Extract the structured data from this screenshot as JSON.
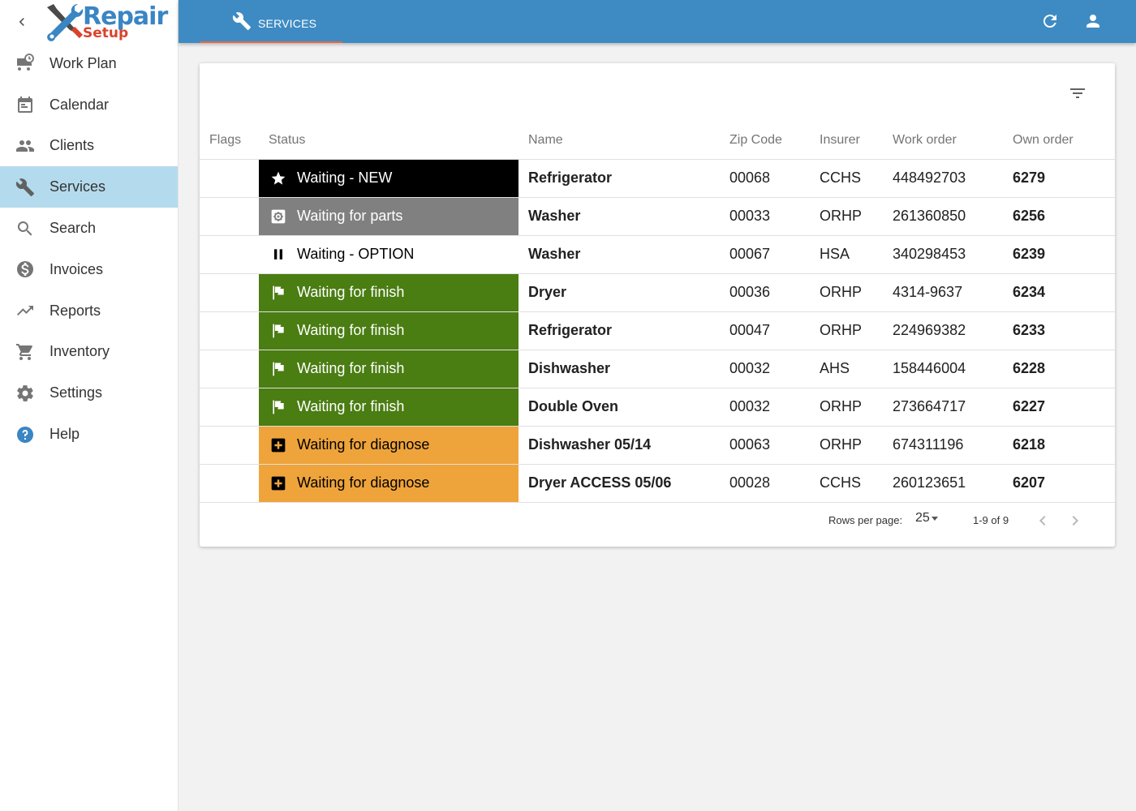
{
  "sidebar": {
    "logo": {
      "word": "Repair",
      "sub": "Setup"
    },
    "items": [
      {
        "label": "Work Plan",
        "icon": "truck-clock-icon"
      },
      {
        "label": "Calendar",
        "icon": "calendar-icon"
      },
      {
        "label": "Clients",
        "icon": "people-icon"
      },
      {
        "label": "Services",
        "icon": "wrench-icon",
        "active": true
      },
      {
        "label": "Search",
        "icon": "search-icon"
      },
      {
        "label": "Invoices",
        "icon": "dollar-icon"
      },
      {
        "label": "Reports",
        "icon": "trending-up-icon"
      },
      {
        "label": "Inventory",
        "icon": "cart-icon"
      },
      {
        "label": "Settings",
        "icon": "gear-icon"
      },
      {
        "label": "Help",
        "icon": "help-icon"
      }
    ]
  },
  "topbar": {
    "tab_label": "SERVICES",
    "colors": {
      "bar": "#3e8bc3",
      "underline": "#e0674a"
    }
  },
  "table": {
    "headers": {
      "flags": "Flags",
      "status": "Status",
      "name": "Name",
      "zip": "Zip Code",
      "insurer": "Insurer",
      "work_order": "Work order",
      "own_order": "Own order"
    },
    "rows": [
      {
        "status": "Waiting - NEW",
        "status_icon": "star-icon",
        "bg": "#000000",
        "fg": "#ffffff",
        "name": "Refrigerator",
        "zip": "00068",
        "insurer": "CCHS",
        "work_order": "448492703",
        "own_order": "6279"
      },
      {
        "status": "Waiting for parts",
        "status_icon": "gear-box-icon",
        "bg": "#808080",
        "fg": "#ffffff",
        "name": "Washer",
        "zip": "00033",
        "insurer": "ORHP",
        "work_order": "261360850",
        "own_order": "6256"
      },
      {
        "status": "Waiting - OPTION",
        "status_icon": "pause-icon",
        "bg": "#ffffff",
        "fg": "#000000",
        "name": "Washer",
        "zip": "00067",
        "insurer": "HSA",
        "work_order": "340298453",
        "own_order": "6239"
      },
      {
        "status": "Waiting for finish",
        "status_icon": "flag-icon",
        "bg": "#4a7d12",
        "fg": "#ffffff",
        "name": "Dryer",
        "zip": "00036",
        "insurer": "ORHP",
        "work_order": "4314-9637",
        "own_order": "6234"
      },
      {
        "status": "Waiting for finish",
        "status_icon": "flag-icon",
        "bg": "#4a7d12",
        "fg": "#ffffff",
        "name": "Refrigerator",
        "zip": "00047",
        "insurer": "ORHP",
        "work_order": "224969382",
        "own_order": "6233"
      },
      {
        "status": "Waiting for finish",
        "status_icon": "flag-icon",
        "bg": "#4a7d12",
        "fg": "#ffffff",
        "name": "Dishwasher",
        "zip": "00032",
        "insurer": "AHS",
        "work_order": "158446004",
        "own_order": "6228"
      },
      {
        "status": "Waiting for finish",
        "status_icon": "flag-icon",
        "bg": "#4a7d12",
        "fg": "#ffffff",
        "name": "Double Oven",
        "zip": "00032",
        "insurer": "ORHP",
        "work_order": "273664717",
        "own_order": "6227"
      },
      {
        "status": "Waiting for diagnose",
        "status_icon": "plus-box-icon",
        "bg": "#efa43b",
        "fg": "#000000",
        "name": "Dishwasher 05/14",
        "zip": "00063",
        "insurer": "ORHP",
        "work_order": "674311196",
        "own_order": "6218"
      },
      {
        "status": "Waiting for diagnose",
        "status_icon": "plus-box-icon",
        "bg": "#efa43b",
        "fg": "#000000",
        "name": "Dryer ACCESS 05/06",
        "zip": "00028",
        "insurer": "CCHS",
        "work_order": "260123651",
        "own_order": "6207"
      }
    ]
  },
  "pagination": {
    "rows_per_page_label": "Rows per page:",
    "rows_per_page": "25",
    "range": "1-9 of 9"
  }
}
